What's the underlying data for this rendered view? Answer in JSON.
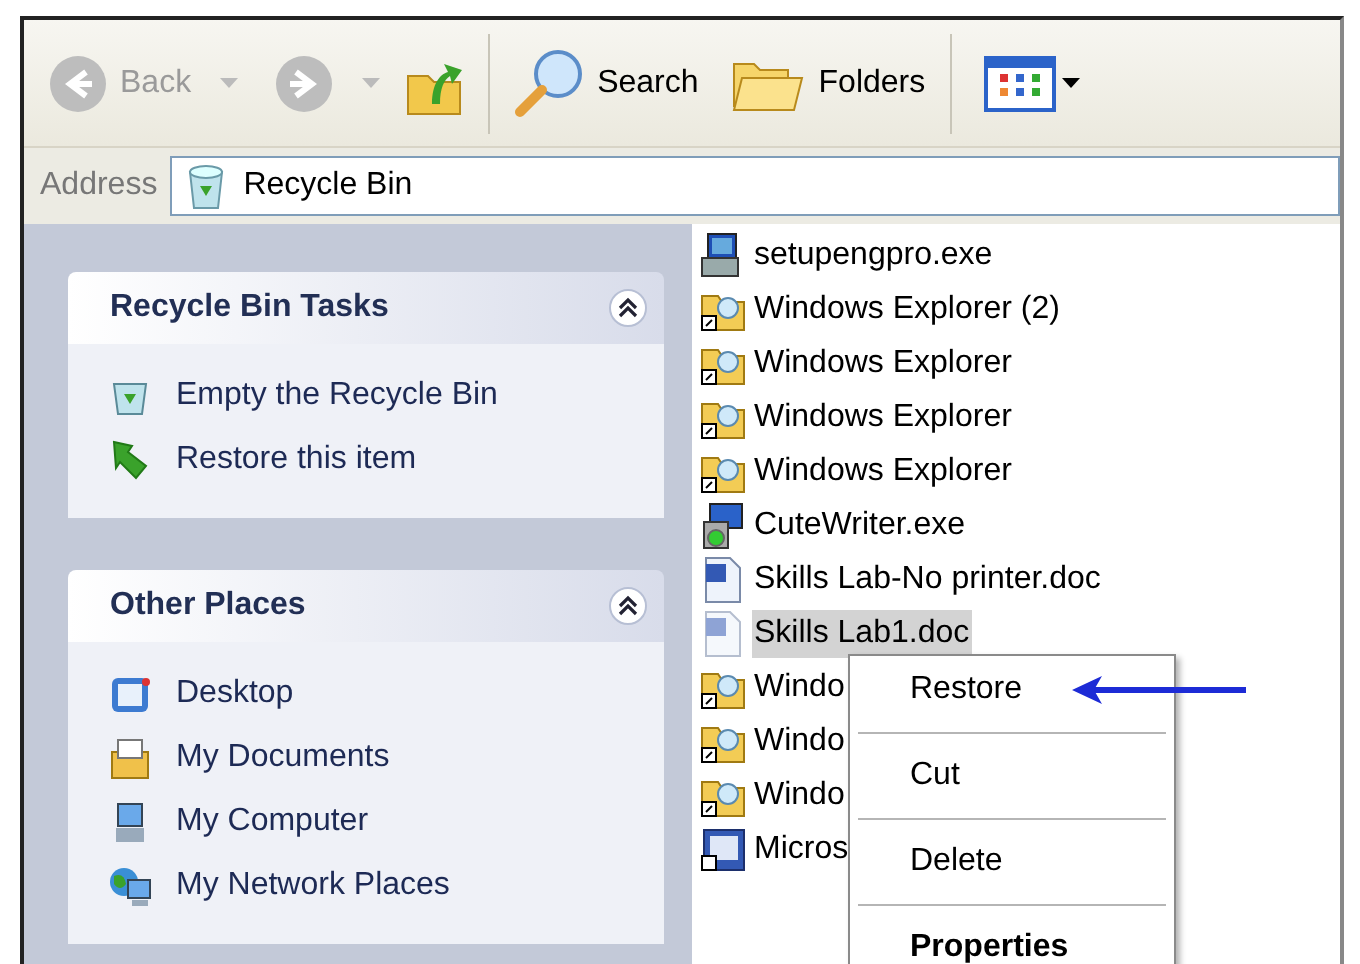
{
  "toolbar": {
    "back": {
      "label": "Back",
      "disabled": true
    },
    "forward": {
      "disabled": true
    },
    "search": "Search",
    "folders": "Folders"
  },
  "address": {
    "label": "Address",
    "value": "Recycle Bin"
  },
  "panels": [
    {
      "title": "Recycle Bin Tasks",
      "expanded": true,
      "items": [
        {
          "label": "Empty the Recycle Bin",
          "kind": "bin"
        },
        {
          "label": "Restore this item",
          "kind": "restore"
        }
      ]
    },
    {
      "title": "Other Places",
      "expanded": true,
      "items": [
        {
          "label": "Desktop",
          "kind": "desktop"
        },
        {
          "label": "My Documents",
          "kind": "documents"
        },
        {
          "label": "My Computer",
          "kind": "computer"
        },
        {
          "label": "My Network Places",
          "kind": "network"
        }
      ]
    }
  ],
  "files": [
    {
      "name": "setupengpro.exe",
      "kind": "setup",
      "selected": false
    },
    {
      "name": "Windows Explorer (2)",
      "kind": "shortcut",
      "selected": false
    },
    {
      "name": "Windows Explorer",
      "kind": "shortcut",
      "selected": false
    },
    {
      "name": "Windows Explorer",
      "kind": "shortcut",
      "selected": false
    },
    {
      "name": "Windows Explorer",
      "kind": "shortcut",
      "selected": false
    },
    {
      "name": "CuteWriter.exe",
      "kind": "cd",
      "selected": false
    },
    {
      "name": "Skills Lab-No printer.doc",
      "kind": "doc",
      "selected": false
    },
    {
      "name": "Skills Lab1.doc",
      "kind": "doc",
      "selected": true
    },
    {
      "name": "Windo",
      "kind": "shortcut",
      "selected": false
    },
    {
      "name": "Windo",
      "kind": "shortcut",
      "selected": false
    },
    {
      "name": "Windo",
      "kind": "shortcut",
      "selected": false
    },
    {
      "name": "Micros",
      "kind": "wordlink",
      "selected": false
    }
  ],
  "context_menu": [
    {
      "label": "Restore",
      "default": false,
      "pointed": true
    },
    {
      "label": "Cut",
      "default": false,
      "pointed": false
    },
    {
      "label": "Delete",
      "default": false,
      "pointed": false
    },
    {
      "label": "Properties",
      "default": true,
      "pointed": false
    }
  ]
}
